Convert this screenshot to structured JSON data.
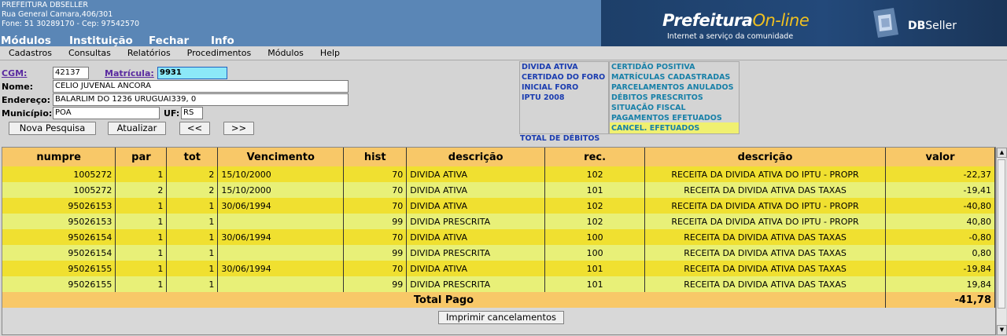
{
  "header": {
    "org_name": "PREFEITURA DBSELLER",
    "address": "Rua General Camara,406/301",
    "contact": "Fone: 51 30289170  -  Cep: 97542570",
    "brand_prefix": "Prefeitura",
    "brand_suffix": "On-line",
    "brand_tagline": "Internet a serviço da comunidade",
    "vendor_bold": "DB",
    "vendor_rest": "Seller"
  },
  "main_menu": [
    "Módulos",
    "Instituição",
    "Fechar",
    "Info"
  ],
  "sub_menu": [
    "Cadastros",
    "Consultas",
    "Relatórios",
    "Procedimentos",
    "Módulos",
    "Help"
  ],
  "form": {
    "cgm_label": "CGM:",
    "cgm_value": "42137",
    "matricula_label": "Matrícula:",
    "matricula_value": "9931",
    "nome_label": "Nome:",
    "nome_value": "CELIO JUVENAL ANCORA",
    "endereco_label": "Endereço:",
    "endereco_value": "BALARLIM DO 1236 URUGUAI339, 0",
    "municipio_label": "Município:",
    "municipio_value": "POA",
    "uf_label": "UF:",
    "uf_value": "RS",
    "btn_nova": "Nova Pesquisa",
    "btn_atualizar": "Atualizar",
    "btn_prev": "<<",
    "btn_next": ">>"
  },
  "links_left": [
    "DIVIDA ATIVA",
    "CERTIDAO DO FORO",
    "INICIAL FORO",
    "IPTU 2008"
  ],
  "links_right": [
    "CERTIDÃO POSITIVA",
    "MATRÍCULAS CADASTRADAS",
    "PARCELAMENTOS ANULADOS",
    "DÉBITOS PRESCRITOS",
    "SITUAÇÃO FISCAL",
    "PAGAMENTOS EFETUADOS",
    "CANCEL. EFETUADOS"
  ],
  "total_debitos": "TOTAL DE DÉBITOS",
  "grid": {
    "headers": [
      "numpre",
      "par",
      "tot",
      "Vencimento",
      "hist",
      "descrição",
      "rec.",
      "descrição",
      "valor"
    ],
    "rows": [
      [
        "1005272",
        "1",
        "2",
        "15/10/2000",
        "70",
        "DIVIDA ATIVA",
        "102",
        "RECEITA DA DIVIDA ATIVA DO IPTU - PROPR",
        "-22,37"
      ],
      [
        "1005272",
        "2",
        "2",
        "15/10/2000",
        "70",
        "DIVIDA ATIVA",
        "101",
        "RECEITA DA DIVIDA ATIVA DAS TAXAS",
        "-19,41"
      ],
      [
        "95026153",
        "1",
        "1",
        "30/06/1994",
        "70",
        "DIVIDA ATIVA",
        "102",
        "RECEITA DA DIVIDA ATIVA DO IPTU - PROPR",
        "-40,80"
      ],
      [
        "95026153",
        "1",
        "1",
        "",
        "99",
        "DIVIDA PRESCRITA",
        "102",
        "RECEITA DA DIVIDA ATIVA DO IPTU - PROPR",
        "40,80"
      ],
      [
        "95026154",
        "1",
        "1",
        "30/06/1994",
        "70",
        "DIVIDA ATIVA",
        "100",
        "RECEITA DA DIVIDA ATIVA DAS TAXAS",
        "-0,80"
      ],
      [
        "95026154",
        "1",
        "1",
        "",
        "99",
        "DIVIDA PRESCRITA",
        "100",
        "RECEITA DA DIVIDA ATIVA DAS TAXAS",
        "0,80"
      ],
      [
        "95026155",
        "1",
        "1",
        "30/06/1994",
        "70",
        "DIVIDA ATIVA",
        "101",
        "RECEITA DA DIVIDA ATIVA DAS TAXAS",
        "-19,84"
      ],
      [
        "95026155",
        "1",
        "1",
        "",
        "99",
        "DIVIDA PRESCRITA",
        "101",
        "RECEITA DA DIVIDA ATIVA DAS TAXAS",
        "19,84"
      ]
    ],
    "total_label": "Total Pago",
    "total_value": "-41,78"
  },
  "print_button": "Imprimir cancelamentos",
  "colors": {
    "header_bg": "#5a86b6",
    "row_a": "#f0e030",
    "row_b": "#e8f078",
    "grid_header": "#f8c868",
    "highlight_input": "#8ce8f8"
  }
}
